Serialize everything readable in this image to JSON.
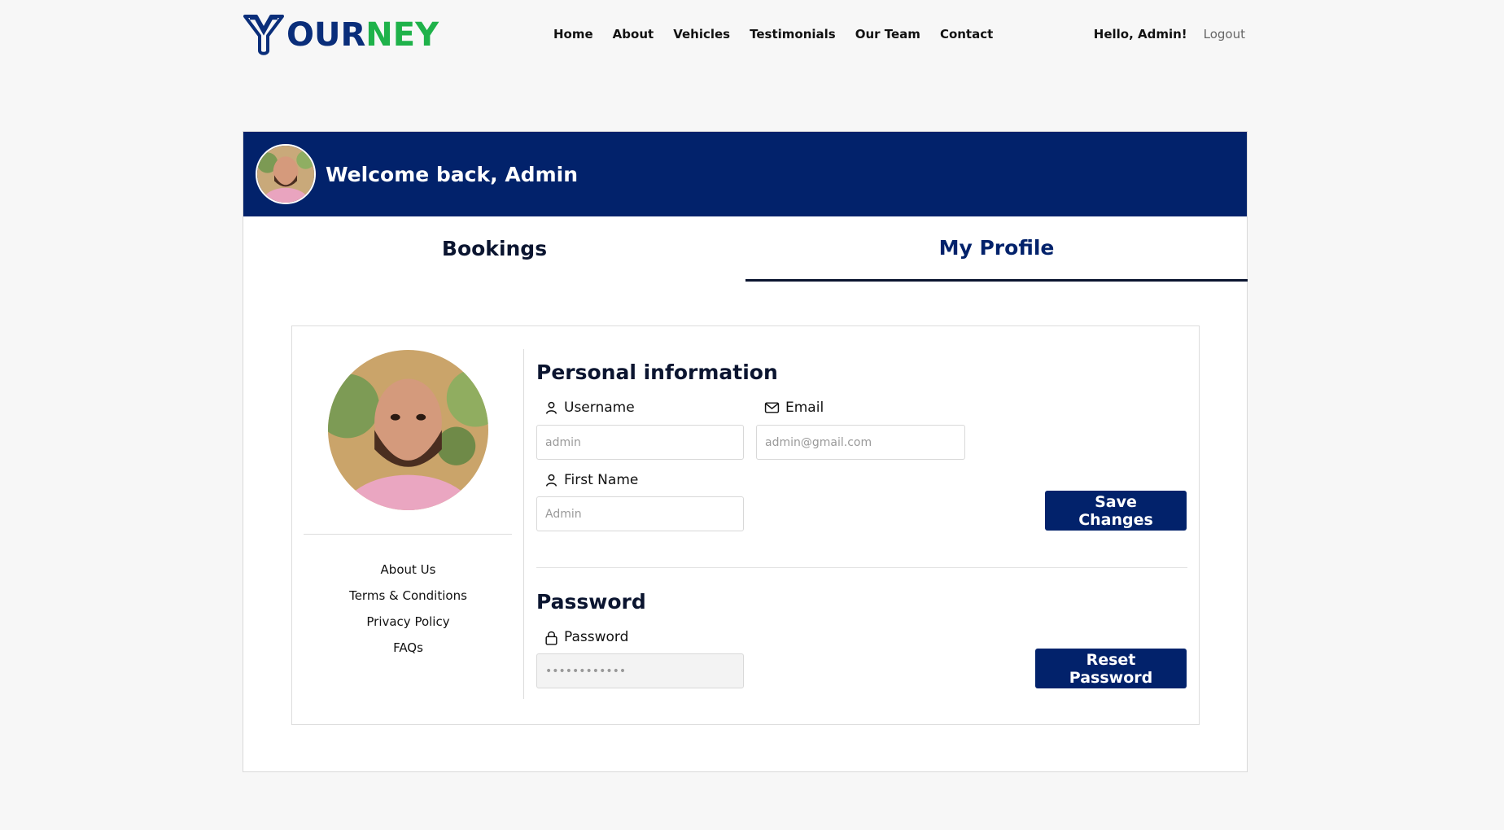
{
  "header": {
    "logo_part1": "OUR",
    "logo_part2": "NEY",
    "nav": [
      "Home",
      "About",
      "Vehicles",
      "Testimonials",
      "Our Team",
      "Contact"
    ],
    "greeting": "Hello, Admin!",
    "logout": "Logout"
  },
  "banner": {
    "welcome": "Welcome back, Admin"
  },
  "tabs": {
    "bookings": "Bookings",
    "profile": "My Profile"
  },
  "sidebar": {
    "links": [
      "About Us",
      "Terms & Conditions",
      "Privacy Policy",
      "FAQs"
    ]
  },
  "personal": {
    "title": "Personal information",
    "username_label": "Username",
    "username_placeholder": "admin",
    "email_label": "Email",
    "email_placeholder": "admin@gmail.com",
    "firstname_label": "First Name",
    "firstname_placeholder": "Admin",
    "save_label": "Save Changes"
  },
  "password": {
    "title": "Password",
    "label": "Password",
    "value": "••••••••••••",
    "reset_label": "Reset Password"
  },
  "colors": {
    "brand_navy": "#02226b",
    "brand_green": "#1fb24a"
  },
  "icons": {
    "username": "user-icon",
    "email": "mail-icon",
    "firstname": "user-icon",
    "password": "lock-icon"
  }
}
